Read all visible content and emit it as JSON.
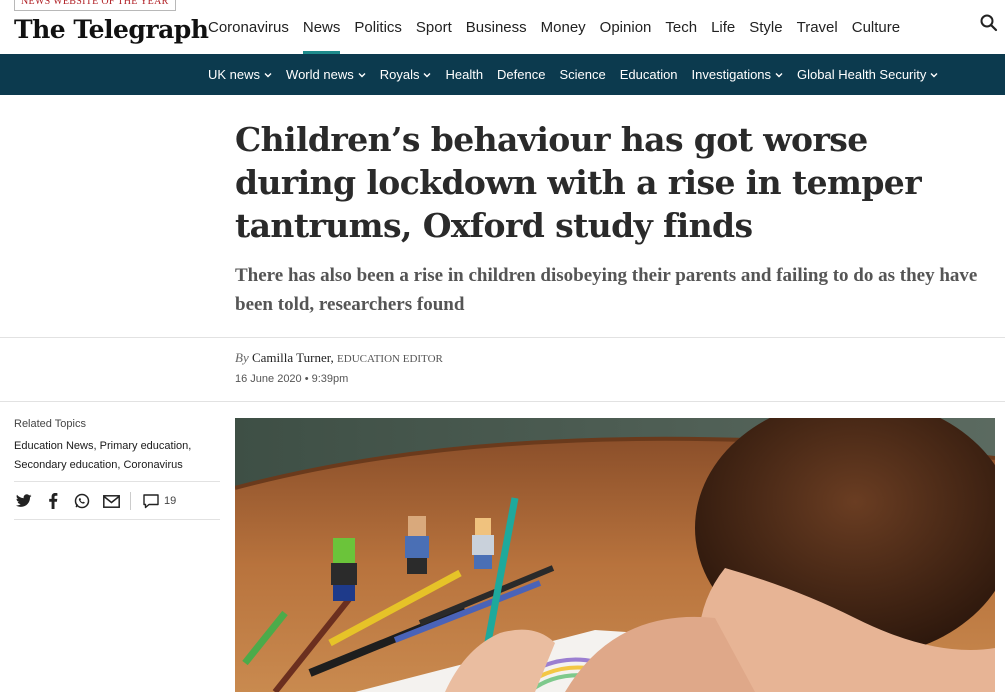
{
  "award": "NEWS WEBSITE OF THE YEAR",
  "logo": "The Telegraph",
  "main_nav": [
    "Coronavirus",
    "News",
    "Politics",
    "Sport",
    "Business",
    "Money",
    "Opinion",
    "Tech",
    "Life",
    "Style",
    "Travel",
    "Culture"
  ],
  "main_nav_active": "News",
  "sub_nav": [
    {
      "label": "UK news",
      "dropdown": true
    },
    {
      "label": "World news",
      "dropdown": true
    },
    {
      "label": "Royals",
      "dropdown": true
    },
    {
      "label": "Health",
      "dropdown": false
    },
    {
      "label": "Defence",
      "dropdown": false
    },
    {
      "label": "Science",
      "dropdown": false
    },
    {
      "label": "Education",
      "dropdown": false
    },
    {
      "label": "Investigations",
      "dropdown": true
    },
    {
      "label": "Global Health Security",
      "dropdown": true
    }
  ],
  "article": {
    "headline": "Children’s behaviour has got worse during lockdown with a rise in temper tantrums, Oxford study finds",
    "standfirst": "There has also been a rise in children disobeying their parents and failing to do as they have been told, researchers found",
    "by_prefix": "By",
    "author": "Camilla Turner,",
    "author_role": "EDUCATION EDITOR",
    "date": "16 June 2020 • 9:39pm"
  },
  "related": {
    "label": "Related Topics",
    "topics": [
      "Education News",
      "Primary education",
      "Secondary education",
      "Coronavirus"
    ]
  },
  "share": {
    "icons": [
      "twitter-icon",
      "facebook-icon",
      "whatsapp-icon",
      "email-icon"
    ],
    "comment_count": "19"
  },
  "colors": {
    "subnav_bg": "#0c3a4e",
    "active_underline": "#1e8b8c",
    "award_red": "#b01f24"
  }
}
